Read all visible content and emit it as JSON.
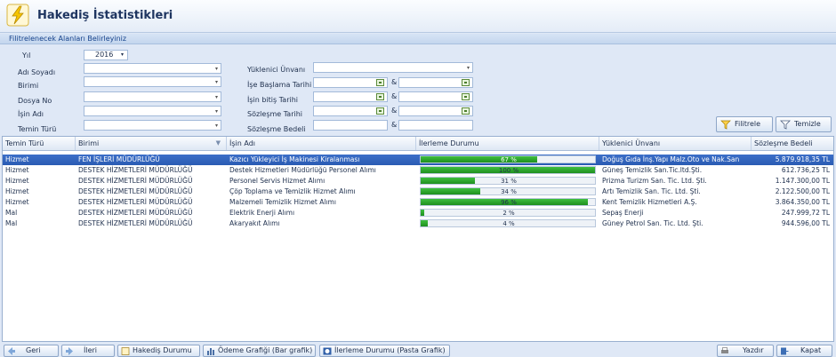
{
  "window": {
    "title": "Hakediş İstatistikleri"
  },
  "filter": {
    "header": "Filitrelenecek Alanları Belirleyiniz",
    "year_label": "Yıl",
    "year_value": "2016",
    "labels": {
      "adi_soyadi": "Adı Soyadı",
      "birimi": "Birimi",
      "dosya_no": "Dosya No",
      "isin_adi": "İşin Adı",
      "temin_turu": "Temin Türü",
      "yuklenici_unvani": "Yüklenici Ünvanı",
      "ise_baslama_tarihi": "İşe Başlama Tarihi",
      "isin_bitis_tarihi": "İşin bitiş Tarihi",
      "sozlesme_tarihi": "Sözleşme Tarihi",
      "sozlesme_bedeli": "Sözleşme Bedeli"
    },
    "amp": "&",
    "filter_button": "Filitrele",
    "clear_button": "Temizle"
  },
  "grid": {
    "columns": [
      "Temin Türü",
      "Birimi",
      "İşin Adı",
      "İlerleme Durumu",
      "Yüklenici Ünvanı",
      "Sözleşme Bedeli"
    ],
    "rows": [
      {
        "temin": "Hizmet",
        "birimi": "FEN İŞLERİ MÜDÜRLÜĞÜ",
        "isin_adi": "Kazıcı Yükleyici İş Makinesi Kiralanması",
        "progress_label": "67 %",
        "progress": 0.67,
        "yuklenici": "Doğuş Gıda İnş.Yapı Malz.Oto ve Nak.San",
        "bedel": "5.879.918,35 TL"
      },
      {
        "temin": "Hizmet",
        "birimi": "DESTEK HİZMETLERİ MÜDÜRLÜĞÜ",
        "isin_adi": "Destek Hizmetleri Müdürlüğü Personel Alımı",
        "progress_label": "100 %",
        "progress": 1.0,
        "yuklenici": "Güneş Temizlik San.Tic.ltd.Şti.",
        "bedel": "612.736,25 TL"
      },
      {
        "temin": "Hizmet",
        "birimi": "DESTEK HİZMETLERİ MÜDÜRLÜĞÜ",
        "isin_adi": "Personel Servis Hizmet Alımı",
        "progress_label": "31 %",
        "progress": 0.31,
        "yuklenici": "Prizma Turizm San. Tic. Ltd. Şti.",
        "bedel": "1.147.300,00 TL"
      },
      {
        "temin": "Hizmet",
        "birimi": "DESTEK HİZMETLERİ MÜDÜRLÜĞÜ",
        "isin_adi": "Çöp Toplama ve Temizlik Hizmet Alımı",
        "progress_label": "34 %",
        "progress": 0.34,
        "yuklenici": "Artı Temizlik San. Tic. Ltd. Şti.",
        "bedel": "2.122.500,00 TL"
      },
      {
        "temin": "Hizmet",
        "birimi": "DESTEK HİZMETLERİ MÜDÜRLÜĞÜ",
        "isin_adi": "Malzemeli Temizlik Hizmet Alımı",
        "progress_label": "96 %",
        "progress": 0.96,
        "yuklenici": "Kent Temizlik Hizmetleri A.Ş.",
        "bedel": "3.864.350,00 TL"
      },
      {
        "temin": "Mal",
        "birimi": "DESTEK HİZMETLERİ MÜDÜRLÜĞÜ",
        "isin_adi": "Elektrik Enerji Alımı",
        "progress_label": "2 %",
        "progress": 0.02,
        "yuklenici": "Sepaş Enerji",
        "bedel": "247.999,72 TL"
      },
      {
        "temin": "Mal",
        "birimi": "DESTEK HİZMETLERİ MÜDÜRLÜĞÜ",
        "isin_adi": "Akaryakıt Alımı",
        "progress_label": "4 %",
        "progress": 0.04,
        "yuklenici": "Güney Petrol San. Tic. Ltd. Şti.",
        "bedel": "944.596,00 TL"
      }
    ]
  },
  "footer": {
    "geri": "Geri",
    "ileri": "İleri",
    "hakedis_durumu": "Hakediş Durumu",
    "odeme_grafigi": "Ödeme Grafiği (Bar grafik)",
    "ilerleme_durumu": "İlerleme Durumu (Pasta Grafik)",
    "yazdir": "Yazdır",
    "kapat": "Kapat"
  },
  "colors": {
    "accent": "#2a5bb3",
    "progress": "#1f8f1f",
    "background": "#dfe8f6"
  }
}
